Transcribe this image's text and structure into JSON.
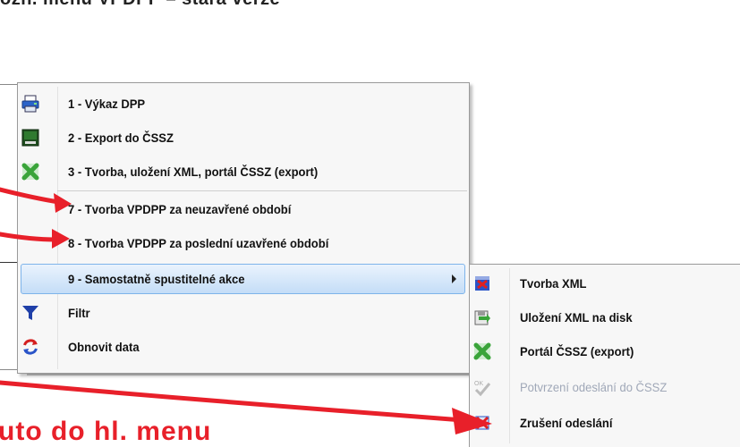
{
  "page": {
    "heading": "ozn. menu VPDPP – stará verze",
    "annotation": "uto do hl. menu"
  },
  "main_menu": {
    "items": [
      {
        "label": "1 - Výkaz DPP",
        "icon": "printer-icon"
      },
      {
        "label": "2 - Export do ČSSZ",
        "icon": "export-terminal-icon"
      },
      {
        "label": "3 - Tvorba, uložení XML, portál ČSSZ (export)",
        "icon": "green-x-icon"
      },
      {
        "label": "7 - Tvorba VPDPP za neuzavřené období",
        "icon": ""
      },
      {
        "label": "8 - Tvorba VPDPP za poslední uzavřené období",
        "icon": ""
      },
      {
        "label": "9 - Samostatně spustitelné akce",
        "icon": "",
        "highlighted": true,
        "has_submenu": true
      },
      {
        "label": "Filtr",
        "icon": "filter-icon"
      },
      {
        "label": "Obnovit data",
        "icon": "refresh-icon"
      }
    ]
  },
  "sub_menu": {
    "items": [
      {
        "label": "Tvorba XML",
        "icon": "xml-create-icon",
        "disabled": false
      },
      {
        "label": "Uložení XML na disk",
        "icon": "save-to-disk-icon",
        "disabled": false
      },
      {
        "label": "Portál ČSSZ (export)",
        "icon": "green-x-icon",
        "disabled": false
      },
      {
        "label": "Potvrzení odeslání do ČSSZ",
        "icon": "ok-check-icon",
        "disabled": true
      },
      {
        "label": "Zrušení odeslání",
        "icon": "cancel-sending-icon",
        "disabled": false
      }
    ]
  },
  "colors": {
    "arrow_red": "#e8202a",
    "highlight_border": "#7eb4ea",
    "disabled_text": "#a0a8b8"
  }
}
